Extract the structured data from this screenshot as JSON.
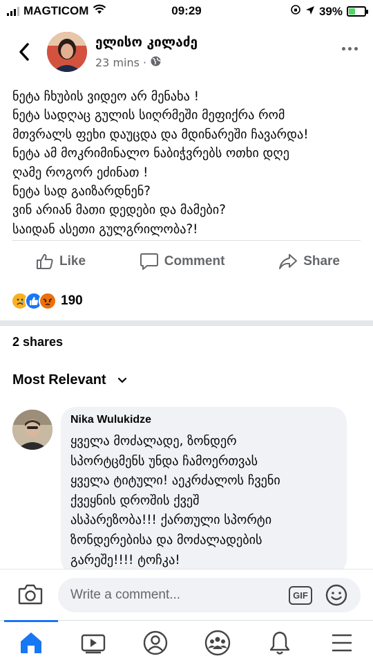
{
  "status_bar": {
    "carrier": "MAGTICOM",
    "time": "09:29",
    "battery_level": "39%",
    "battery_fraction": 0.39
  },
  "post": {
    "author": "ელისო კილაძე",
    "time": "23 mins",
    "privacy_icon": "globe-icon",
    "text_lines": [
      "ნეტა ჩხუბის ვიდეო არ მენახა !",
      "ნეტა სადღაც გულის სიღრმეში მეფიქრა რომ",
      "მთვრალს ფეხი დაუცდა და მდინარეში ჩავარდა!",
      "ნეტა ამ მოკრიმინალო ნაბიჭვრებს ოთხი დღე",
      "ღამე როგორ ეძინათ !",
      "ნეტა სად გაიზარდნენ?",
      "ვინ არიან მათი დედები და მამები?",
      "საიდან ასეთი გულგრილობა?!"
    ],
    "actions": {
      "like": "Like",
      "comment": "Comment",
      "share": "Share"
    },
    "reactions": {
      "icons": [
        "sad-reaction-icon",
        "like-reaction-icon",
        "angry-reaction-icon"
      ],
      "count": "190"
    },
    "shares": "2 shares"
  },
  "comments": {
    "sort_label": "Most Relevant",
    "items": [
      {
        "author": "Nika Wulukidze",
        "text_lines": [
          "ყველა მოძალადე, ზონდერ",
          "სპორტცმენს უნდა ჩამოერთვას",
          "ყველა ტიტული! აეკრძალოს ჩვენი",
          "ქვეყნის დროშის ქვეშ",
          "ასპარეზობა!!! ქართული  სპორტი",
          "ზონდერებისა და მოძალადების",
          "გარეშე!!!! ტოჩკა!"
        ]
      }
    ]
  },
  "composer": {
    "placeholder": "Write a comment...",
    "gif_label": "GIF"
  },
  "nav": {
    "items": [
      "home-icon",
      "watch-icon",
      "profile-icon",
      "groups-icon",
      "notifications-icon",
      "menu-icon"
    ],
    "active": "home-icon"
  },
  "colors": {
    "accent": "#1877f2",
    "secondary_text": "#65676b",
    "bubble": "#f0f2f5",
    "sad": "#f7b125",
    "like": "#1877f2",
    "angry": "#e9710f"
  }
}
